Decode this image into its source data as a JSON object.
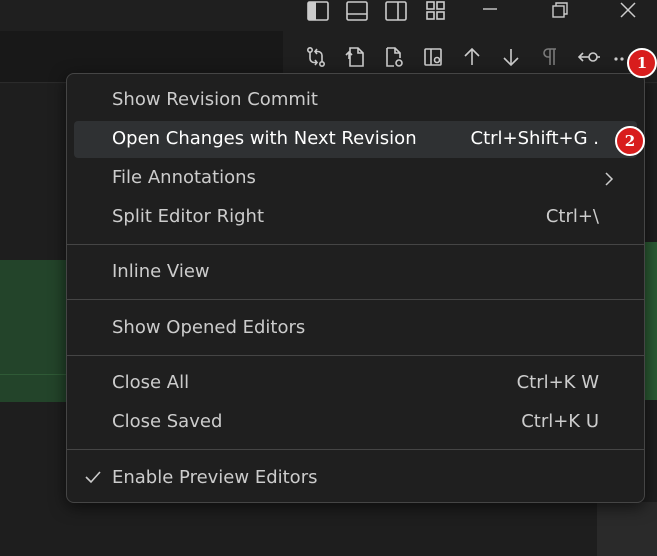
{
  "titlebar": {
    "layout_icons": [
      "toggle-primary-sidebar-icon",
      "toggle-panel-icon",
      "toggle-secondary-sidebar-icon",
      "customize-layout-icon"
    ],
    "window_controls": [
      "minimize-icon",
      "restore-icon",
      "close-icon"
    ]
  },
  "toolbar": {
    "icons": [
      "compare-changes-icon",
      "open-file-icon",
      "open-file-at-revision-icon",
      "toggle-file-blame-icon",
      "previous-change-icon",
      "next-change-icon",
      "show-whitespace-icon",
      "git-compare-icon",
      "more-actions-icon"
    ]
  },
  "menu": {
    "items": [
      {
        "label": "Show Revision Commit",
        "shortcut": ""
      },
      {
        "label": "Open Changes with Next Revision",
        "shortcut": "Ctrl+Shift+G ."
      },
      {
        "label": "File Annotations",
        "shortcut": ""
      },
      {
        "label": "Split Editor Right",
        "shortcut": "Ctrl+\\"
      },
      {
        "label": "Inline View",
        "shortcut": ""
      },
      {
        "label": "Show Opened Editors",
        "shortcut": ""
      },
      {
        "label": "Close All",
        "shortcut": "Ctrl+K W"
      },
      {
        "label": "Close Saved",
        "shortcut": "Ctrl+K U"
      },
      {
        "label": "Enable Preview Editors",
        "shortcut": ""
      }
    ]
  },
  "badges": {
    "one": "1",
    "two": "2"
  },
  "colors": {
    "menu_bg": "#1f1f1f",
    "selected_bg": "#2f3133",
    "badge": "#d81d1d",
    "diff_green": "#23442a"
  }
}
